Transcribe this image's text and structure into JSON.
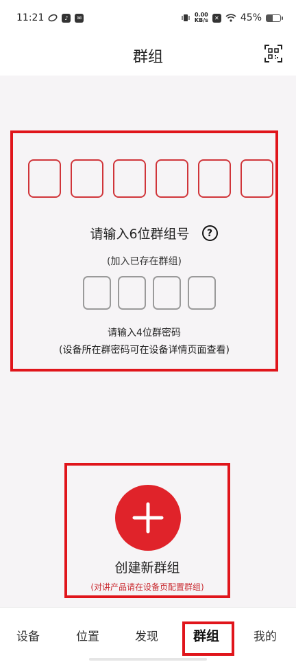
{
  "status_bar": {
    "time": "11:21",
    "net_speed_value": "0.00",
    "net_speed_unit": "KB/s",
    "battery_percent": "45%",
    "battery_level": 0.45
  },
  "header": {
    "title": "群组"
  },
  "join": {
    "group_digit_count": 6,
    "password_digit_count": 4,
    "prompt": "请输入6位群组号",
    "help_symbol": "?",
    "subtitle": "(加入已存在群组)",
    "password_prompt": "请输入4位群密码",
    "password_hint": "(设备所在群密码可在设备详情页面查看)"
  },
  "create": {
    "label": "创建新群组",
    "hint": "(对讲产品请在设备页配置群组)"
  },
  "tabs": [
    {
      "label": "设备"
    },
    {
      "label": "位置"
    },
    {
      "label": "发现"
    },
    {
      "label": "群组",
      "active": true
    },
    {
      "label": "我的"
    }
  ],
  "colors": {
    "accent": "#e0151b",
    "digit_border": "#d0353a",
    "password_border": "#9a9a9a",
    "hint_text": "#c9282e"
  }
}
